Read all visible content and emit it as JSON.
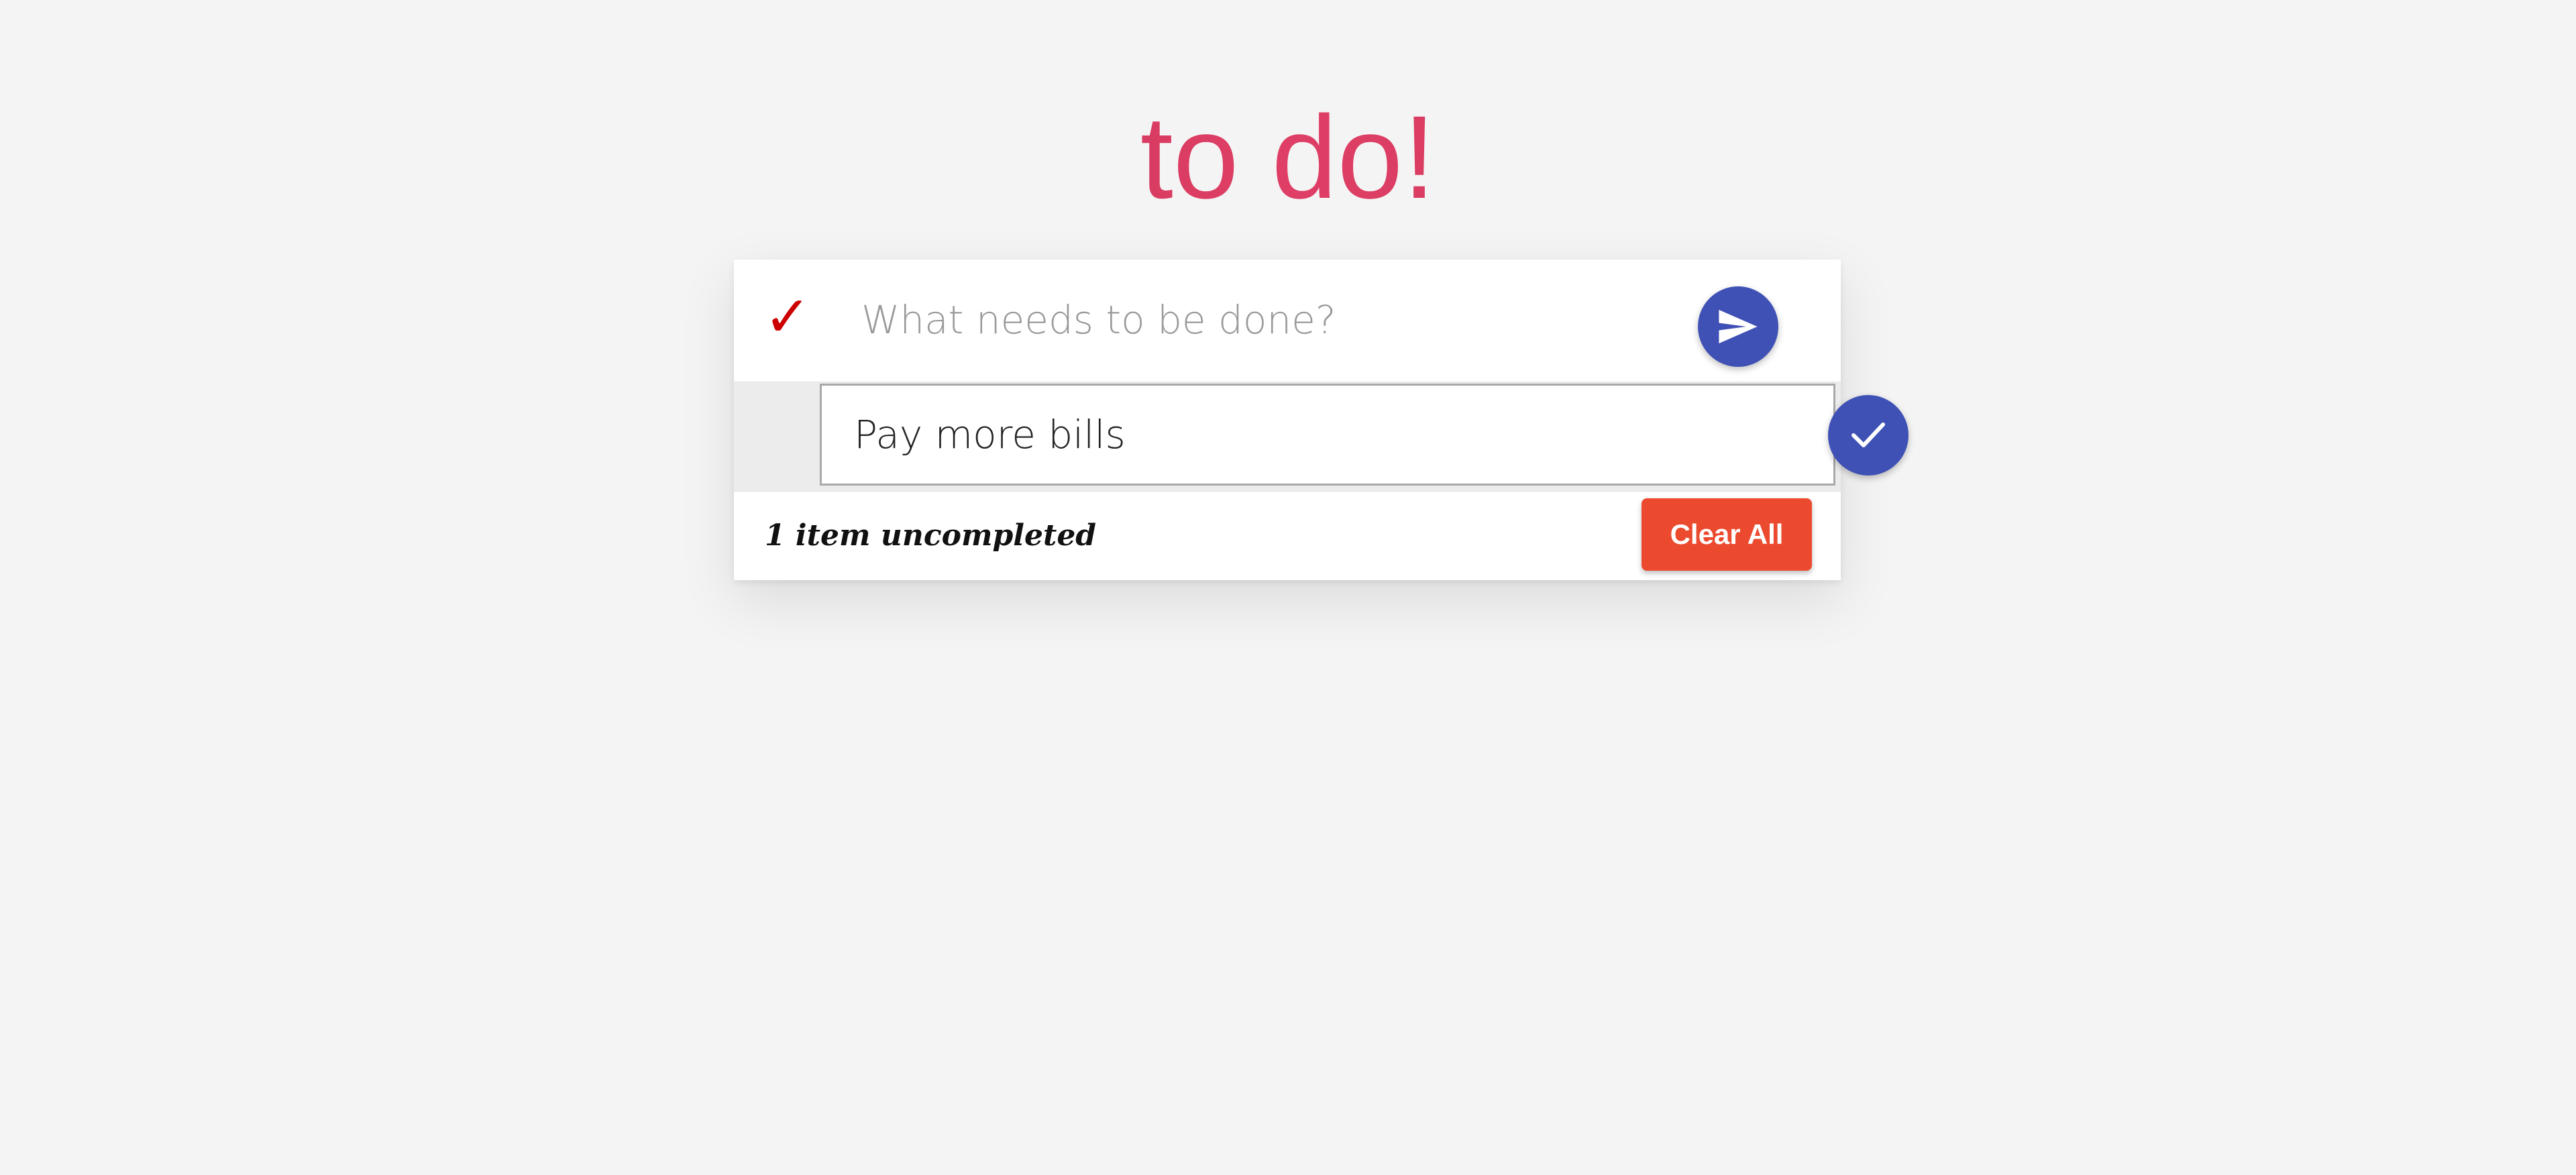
{
  "app": {
    "title": "to do!"
  },
  "new_todo": {
    "toggle_all_glyph": "✓",
    "placeholder": "What needs to be done?",
    "value": "",
    "submit_icon": "send-icon"
  },
  "todos": [
    {
      "label": "Pay more bills",
      "completed": false,
      "action_icon": "check-icon"
    }
  ],
  "footer": {
    "count_text": "1 item uncompleted",
    "clear_label": "Clear All"
  },
  "colors": {
    "title_gradient_start": "#a8213f",
    "title_gradient_mid": "#df3f66",
    "accent_fab": "#3f51b5",
    "toggle_check": "#cc0000",
    "clear_button": "#ec4a2f",
    "background": "#f4f4f4"
  }
}
